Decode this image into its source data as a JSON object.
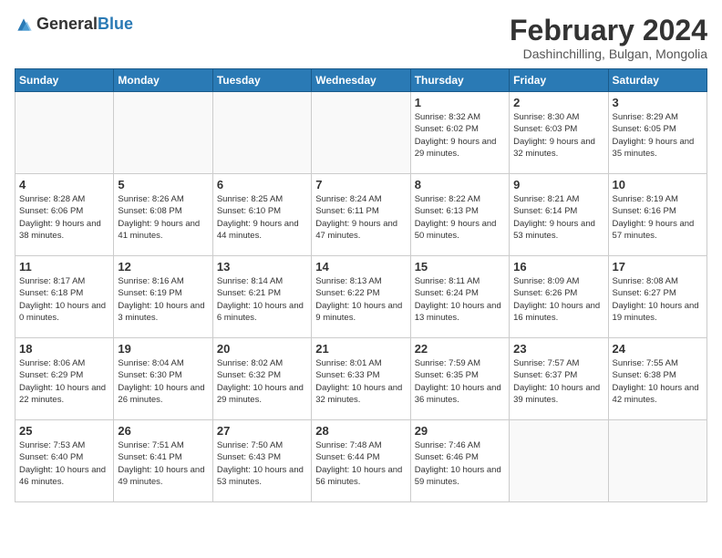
{
  "header": {
    "logo_general": "General",
    "logo_blue": "Blue",
    "title": "February 2024",
    "subtitle": "Dashinchilling, Bulgan, Mongolia"
  },
  "weekdays": [
    "Sunday",
    "Monday",
    "Tuesday",
    "Wednesday",
    "Thursday",
    "Friday",
    "Saturday"
  ],
  "weeks": [
    [
      {
        "day": "",
        "info": ""
      },
      {
        "day": "",
        "info": ""
      },
      {
        "day": "",
        "info": ""
      },
      {
        "day": "",
        "info": ""
      },
      {
        "day": "1",
        "info": "Sunrise: 8:32 AM\nSunset: 6:02 PM\nDaylight: 9 hours and 29 minutes."
      },
      {
        "day": "2",
        "info": "Sunrise: 8:30 AM\nSunset: 6:03 PM\nDaylight: 9 hours and 32 minutes."
      },
      {
        "day": "3",
        "info": "Sunrise: 8:29 AM\nSunset: 6:05 PM\nDaylight: 9 hours and 35 minutes."
      }
    ],
    [
      {
        "day": "4",
        "info": "Sunrise: 8:28 AM\nSunset: 6:06 PM\nDaylight: 9 hours and 38 minutes."
      },
      {
        "day": "5",
        "info": "Sunrise: 8:26 AM\nSunset: 6:08 PM\nDaylight: 9 hours and 41 minutes."
      },
      {
        "day": "6",
        "info": "Sunrise: 8:25 AM\nSunset: 6:10 PM\nDaylight: 9 hours and 44 minutes."
      },
      {
        "day": "7",
        "info": "Sunrise: 8:24 AM\nSunset: 6:11 PM\nDaylight: 9 hours and 47 minutes."
      },
      {
        "day": "8",
        "info": "Sunrise: 8:22 AM\nSunset: 6:13 PM\nDaylight: 9 hours and 50 minutes."
      },
      {
        "day": "9",
        "info": "Sunrise: 8:21 AM\nSunset: 6:14 PM\nDaylight: 9 hours and 53 minutes."
      },
      {
        "day": "10",
        "info": "Sunrise: 8:19 AM\nSunset: 6:16 PM\nDaylight: 9 hours and 57 minutes."
      }
    ],
    [
      {
        "day": "11",
        "info": "Sunrise: 8:17 AM\nSunset: 6:18 PM\nDaylight: 10 hours and 0 minutes."
      },
      {
        "day": "12",
        "info": "Sunrise: 8:16 AM\nSunset: 6:19 PM\nDaylight: 10 hours and 3 minutes."
      },
      {
        "day": "13",
        "info": "Sunrise: 8:14 AM\nSunset: 6:21 PM\nDaylight: 10 hours and 6 minutes."
      },
      {
        "day": "14",
        "info": "Sunrise: 8:13 AM\nSunset: 6:22 PM\nDaylight: 10 hours and 9 minutes."
      },
      {
        "day": "15",
        "info": "Sunrise: 8:11 AM\nSunset: 6:24 PM\nDaylight: 10 hours and 13 minutes."
      },
      {
        "day": "16",
        "info": "Sunrise: 8:09 AM\nSunset: 6:26 PM\nDaylight: 10 hours and 16 minutes."
      },
      {
        "day": "17",
        "info": "Sunrise: 8:08 AM\nSunset: 6:27 PM\nDaylight: 10 hours and 19 minutes."
      }
    ],
    [
      {
        "day": "18",
        "info": "Sunrise: 8:06 AM\nSunset: 6:29 PM\nDaylight: 10 hours and 22 minutes."
      },
      {
        "day": "19",
        "info": "Sunrise: 8:04 AM\nSunset: 6:30 PM\nDaylight: 10 hours and 26 minutes."
      },
      {
        "day": "20",
        "info": "Sunrise: 8:02 AM\nSunset: 6:32 PM\nDaylight: 10 hours and 29 minutes."
      },
      {
        "day": "21",
        "info": "Sunrise: 8:01 AM\nSunset: 6:33 PM\nDaylight: 10 hours and 32 minutes."
      },
      {
        "day": "22",
        "info": "Sunrise: 7:59 AM\nSunset: 6:35 PM\nDaylight: 10 hours and 36 minutes."
      },
      {
        "day": "23",
        "info": "Sunrise: 7:57 AM\nSunset: 6:37 PM\nDaylight: 10 hours and 39 minutes."
      },
      {
        "day": "24",
        "info": "Sunrise: 7:55 AM\nSunset: 6:38 PM\nDaylight: 10 hours and 42 minutes."
      }
    ],
    [
      {
        "day": "25",
        "info": "Sunrise: 7:53 AM\nSunset: 6:40 PM\nDaylight: 10 hours and 46 minutes."
      },
      {
        "day": "26",
        "info": "Sunrise: 7:51 AM\nSunset: 6:41 PM\nDaylight: 10 hours and 49 minutes."
      },
      {
        "day": "27",
        "info": "Sunrise: 7:50 AM\nSunset: 6:43 PM\nDaylight: 10 hours and 53 minutes."
      },
      {
        "day": "28",
        "info": "Sunrise: 7:48 AM\nSunset: 6:44 PM\nDaylight: 10 hours and 56 minutes."
      },
      {
        "day": "29",
        "info": "Sunrise: 7:46 AM\nSunset: 6:46 PM\nDaylight: 10 hours and 59 minutes."
      },
      {
        "day": "",
        "info": ""
      },
      {
        "day": "",
        "info": ""
      }
    ]
  ]
}
